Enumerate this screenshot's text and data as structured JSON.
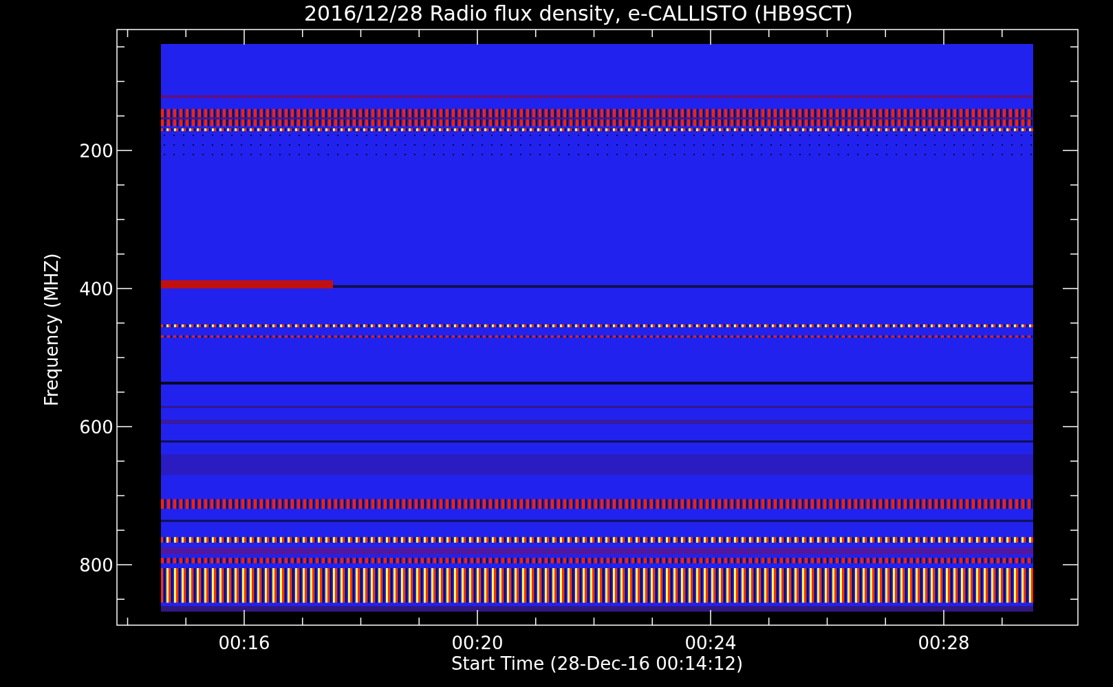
{
  "title": "2016/12/28  Radio flux density, e-CALLISTO (HB9SCT)",
  "y_axis": {
    "label": "Frequency (MHZ)",
    "ticks": [
      "200",
      "400",
      "600",
      "800"
    ]
  },
  "x_axis": {
    "label": "Start Time (28-Dec-16 00:14:12)",
    "ticks": [
      "00:16",
      "00:20",
      "00:24",
      "00:28"
    ]
  }
}
